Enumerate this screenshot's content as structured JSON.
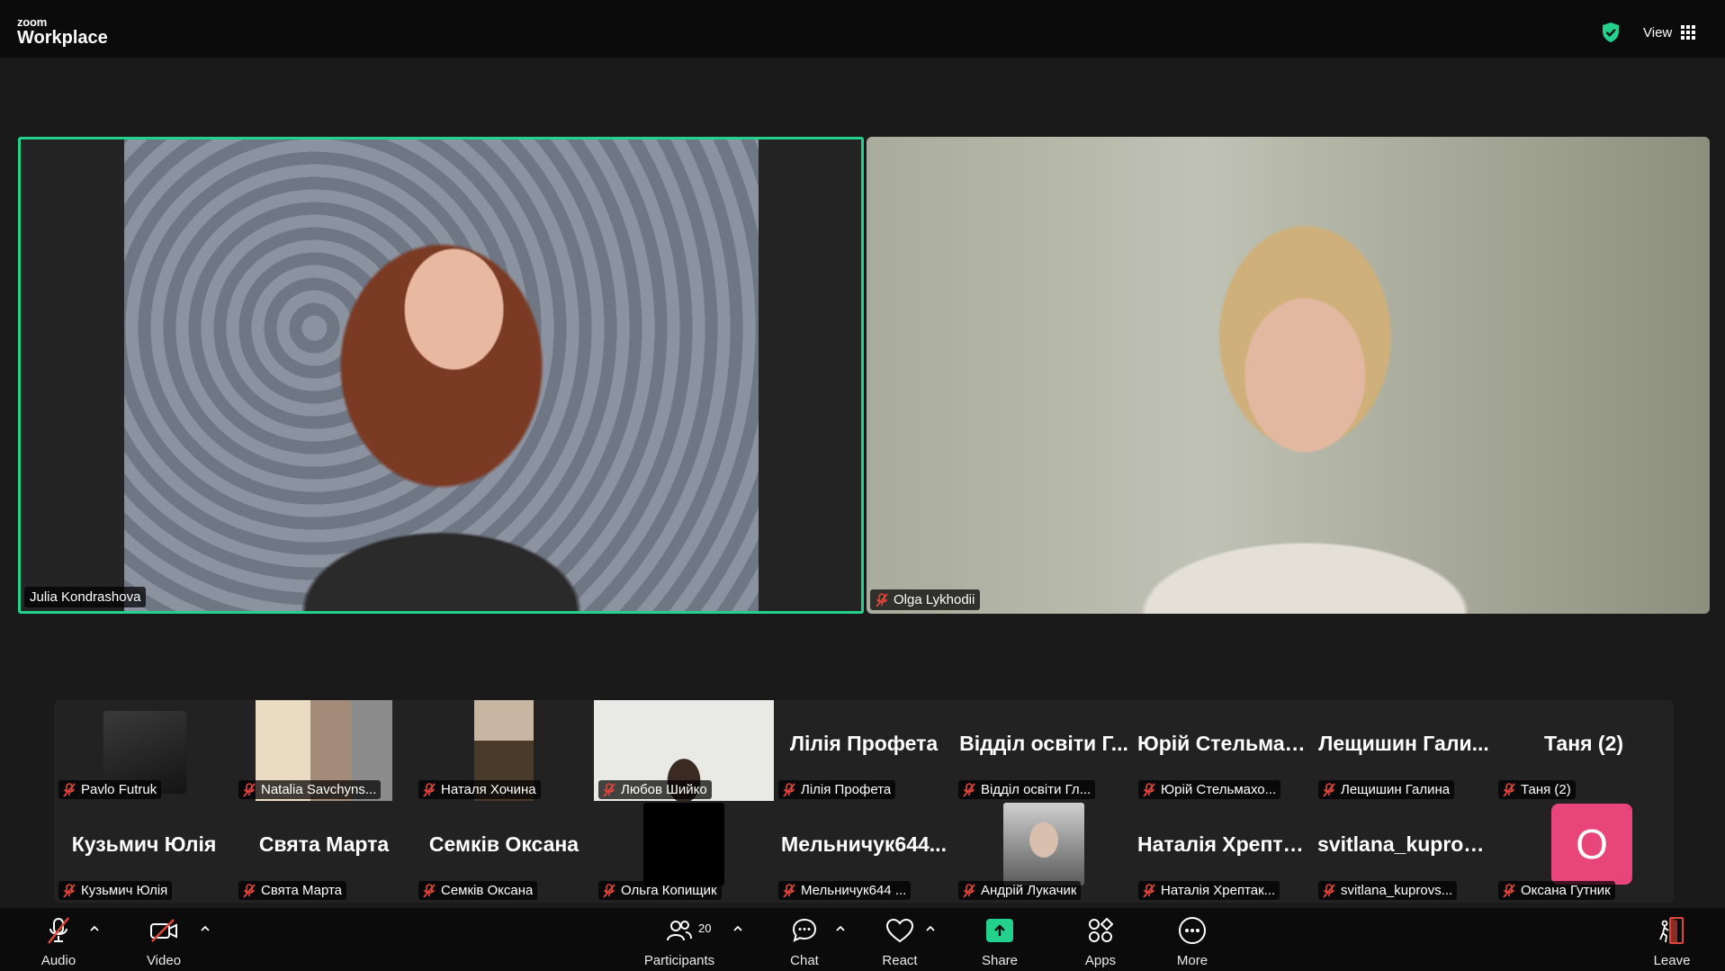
{
  "app": {
    "brand_small": "zoom",
    "brand_big": "Workplace"
  },
  "header": {
    "view_label": "View"
  },
  "speakers": [
    {
      "name": "Julia Kondrashova",
      "muted": false
    },
    {
      "name": "Olga Lykhodii",
      "muted": true
    }
  ],
  "gallery_row1": [
    {
      "display": "",
      "label": "Pavlo Futruk",
      "video": true
    },
    {
      "display": "",
      "label": "Natalia Savchyns...",
      "video": true
    },
    {
      "display": "",
      "label": "Наталя Хочина",
      "video": true
    },
    {
      "display": "",
      "label": "Любов Шийко",
      "video": true
    },
    {
      "display": "Лілія Профета",
      "label": "Лілія Профета",
      "video": false
    },
    {
      "display": "Відділ освіти Г...",
      "label": "Відділ освіти Гл...",
      "video": false
    },
    {
      "display": "Юрій Стельмах...",
      "label": "Юрій Стельмахо...",
      "video": false
    },
    {
      "display": "Лещишин Гали...",
      "label": "Лещишин Галина",
      "video": false
    },
    {
      "display": "Таня (2)",
      "label": "Таня (2)",
      "video": false
    }
  ],
  "gallery_row2": [
    {
      "display": "Кузьмич Юлія",
      "label": "Кузьмич Юлія",
      "video": false
    },
    {
      "display": "Свята Марта",
      "label": "Свята Марта",
      "video": false
    },
    {
      "display": "Семків Оксана",
      "label": "Семків Оксана",
      "video": false
    },
    {
      "display": "",
      "label": "Ольга Копищик",
      "video": true
    },
    {
      "display": "Мельничук644...",
      "label": "Мельничук644 ...",
      "video": false
    },
    {
      "display": "",
      "label": "Андрій Лукачик",
      "video": true
    },
    {
      "display": "Наталія Хрепта...",
      "label": "Наталія Хрептак...",
      "video": false
    },
    {
      "display": "svitlana_kuprov...",
      "label": "svitlana_kuprovs...",
      "video": false
    },
    {
      "display": "",
      "label": "Оксана Гутник",
      "video": false,
      "avatar_letter": "О"
    }
  ],
  "toolbar": {
    "audio": "Audio",
    "video": "Video",
    "participants": "Participants",
    "participants_count": "20",
    "chat": "Chat",
    "react": "React",
    "share": "Share",
    "apps": "Apps",
    "more": "More",
    "leave": "Leave"
  },
  "colors": {
    "active_speaker": "#22d18b",
    "mute_red": "#e0453a",
    "avatar_pink": "#e8467b"
  }
}
